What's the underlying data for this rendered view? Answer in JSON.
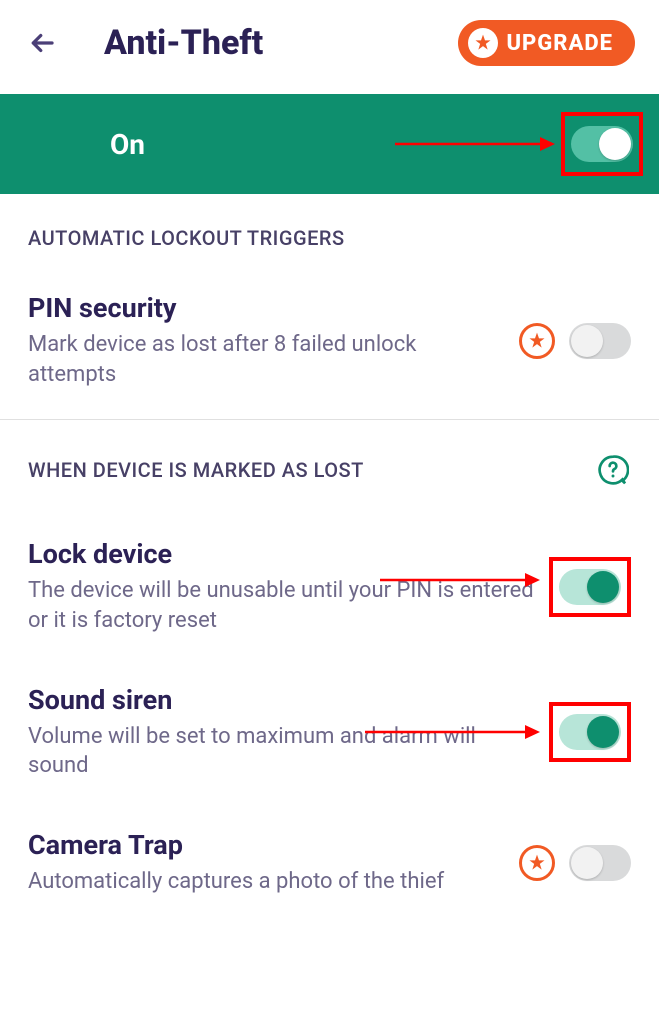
{
  "header": {
    "title": "Anti-Theft",
    "upgrade_label": "UPGRADE"
  },
  "status": {
    "label": "On",
    "on": true
  },
  "sections": {
    "triggers_header": "AUTOMATIC LOCKOUT TRIGGERS",
    "lost_header": "WHEN DEVICE IS MARKED AS LOST"
  },
  "settings": {
    "pin_security": {
      "title": "PIN security",
      "desc": "Mark device as lost after 8 failed unlock attempts",
      "premium": true,
      "on": false
    },
    "lock_device": {
      "title": "Lock device",
      "desc": "The device will be unusable until your PIN is entered or it is factory reset",
      "premium": false,
      "on": true
    },
    "sound_siren": {
      "title": "Sound siren",
      "desc": "Volume will be set to maximum and alarm will sound",
      "premium": false,
      "on": true
    },
    "camera_trap": {
      "title": "Camera Trap",
      "desc": "Automatically captures a photo of the thief",
      "premium": true,
      "on": false
    }
  },
  "colors": {
    "accent_orange": "#F15A24",
    "accent_green": "#0E8F6E",
    "annotation_red": "#FF0000"
  }
}
